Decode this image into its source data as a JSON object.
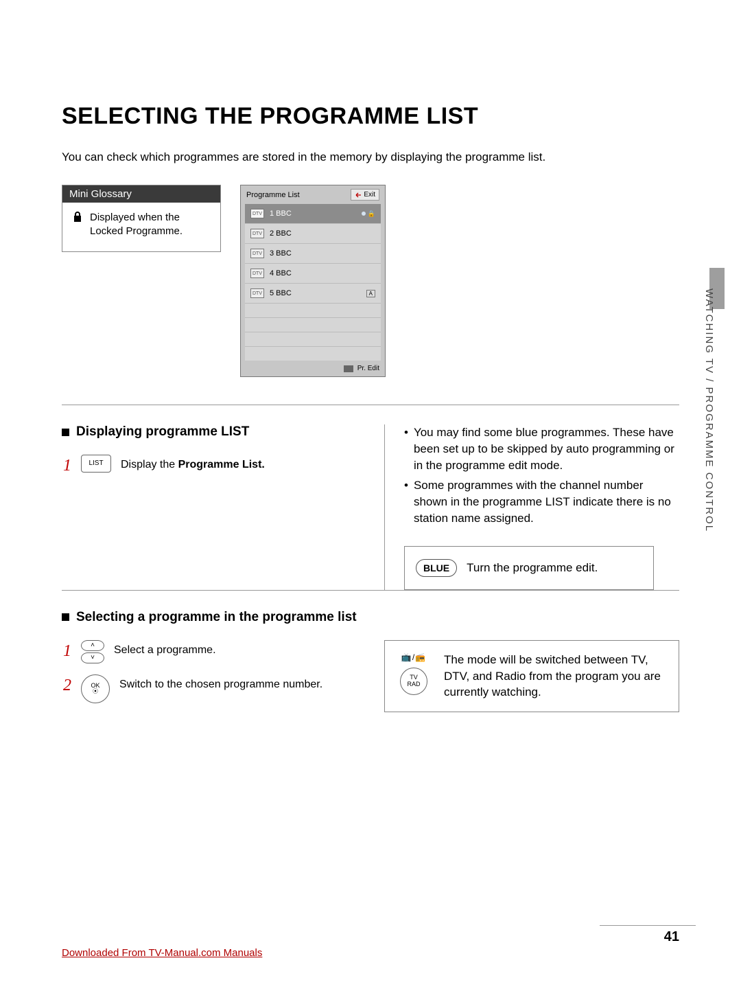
{
  "title": "SELECTING THE PROGRAMME LIST",
  "intro": "You can check which programmes are stored in the memory by displaying the programme list.",
  "glossary": {
    "header": "Mini Glossary",
    "text": "Displayed when the Locked Programme."
  },
  "osd": {
    "title": "Programme List",
    "exit": "Exit",
    "dtv": "DTV",
    "items": [
      {
        "label": "1 BBC",
        "active": true,
        "dot": true,
        "lock": true
      },
      {
        "label": "2 BBC"
      },
      {
        "label": "3 BBC"
      },
      {
        "label": "4 BBC"
      },
      {
        "label": "5 BBC",
        "a": true
      }
    ],
    "a_label": "A",
    "footer": "Pr. Edit"
  },
  "displaying": {
    "heading": "Displaying programme LIST",
    "step1_num": "1",
    "list_btn": "LIST",
    "step1_text_pre": "Display the ",
    "step1_text_bold": "Programme List."
  },
  "notes": {
    "items": [
      "You may find some blue programmes. These have been set up to be skipped by auto programming or in the programme edit mode.",
      "Some programmes with the channel number shown in the programme LIST indicate there is no station name assigned."
    ],
    "blue_label": "BLUE",
    "blue_text": "Turn the programme edit."
  },
  "selecting": {
    "heading": "Selecting a programme in the programme list",
    "step1_num": "1",
    "step1_text": "Select a programme.",
    "step2_num": "2",
    "ok_label": "OK",
    "ok_dot": "⦿",
    "step2_text": "Switch to the chosen programme number.",
    "tvrad_top": "📺/📻",
    "tvrad1": "TV",
    "tvrad2": "RAD",
    "right_text": "The mode will be switched between TV, DTV, and Radio from the program you are currently watching."
  },
  "side_label": "WATCHING TV / PROGRAMME CONTROL",
  "page_number": "41",
  "footer_link": "Downloaded From TV-Manual.com Manuals"
}
